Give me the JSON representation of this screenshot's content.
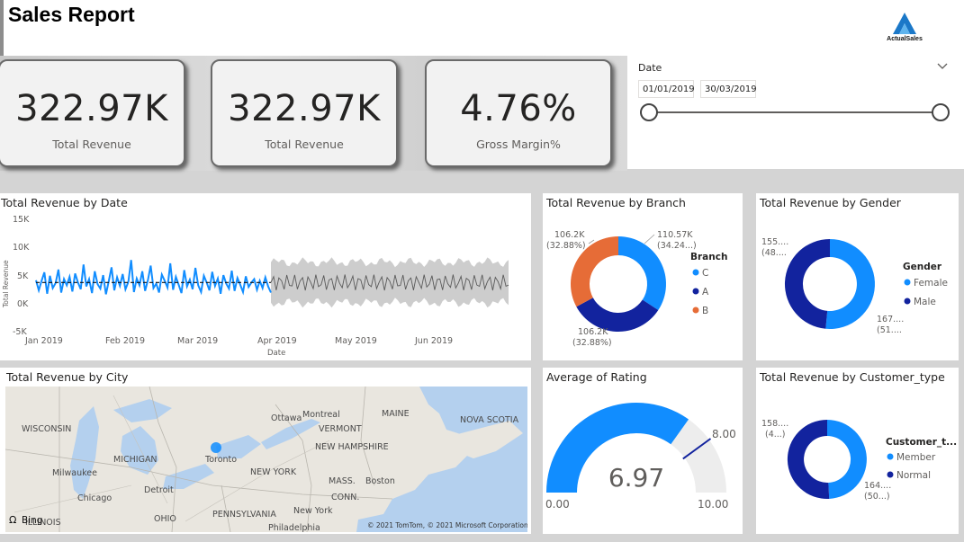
{
  "header": {
    "title": "Sales Report",
    "logo_text": "ActualSales"
  },
  "kpis": [
    {
      "value": "322.97K",
      "label": "Total Revenue"
    },
    {
      "value": "322.97K",
      "label": "Total Revenue"
    },
    {
      "value": "4.76%",
      "label": "Gross Margin%"
    }
  ],
  "slicer": {
    "title": "Date",
    "start": "01/01/2019",
    "end": "30/03/2019"
  },
  "colors": {
    "blue": "#118DFF",
    "navy": "#12239E",
    "orange": "#E66C37",
    "forecast": "#c8c8c8"
  },
  "line_chart": {
    "title": "Total Revenue by Date",
    "ylabel": "Total Revenue",
    "xlabel": "Date",
    "y_ticks": [
      "15K",
      "10K",
      "5K",
      "0K",
      "-5K"
    ],
    "x_ticks": [
      "Jan 2019",
      "Feb 2019",
      "Mar 2019",
      "Apr 2019",
      "May 2019",
      "Jun 2019"
    ]
  },
  "branch_chart": {
    "title": "Total Revenue by Branch",
    "legend_title": "Branch",
    "label_top_left_1": "106.2K",
    "label_top_left_2": "(32.88%)",
    "label_top_right_1": "110.57K",
    "label_top_right_2": "(34.24...)",
    "label_bottom_1": "106.2K",
    "label_bottom_2": "(32.88%)",
    "legend": [
      "C",
      "A",
      "B"
    ]
  },
  "gender_chart": {
    "title": "Total Revenue by Gender",
    "legend_title": "Gender",
    "label_left_1": "155....",
    "label_left_2": "(48....",
    "label_right_1": "167....",
    "label_right_2": "(51....",
    "legend": [
      "Female",
      "Male"
    ]
  },
  "map": {
    "title": "Total Revenue by City",
    "places": [
      "Ottawa",
      "Montreal",
      "MAINE",
      "NOVA SCOTIA",
      "VERMONT",
      "WISCONSIN",
      "NEW HAMPSHIRE",
      "MICHIGAN",
      "Toronto",
      "NEW YORK",
      "Milwaukee",
      "MASS.",
      "Boston",
      "Detroit",
      "Chicago",
      "CONN.",
      "OHIO",
      "PENNSYLVANIA",
      "New York",
      "ILLINOIS",
      "Philadelphia"
    ],
    "bing": "Bing",
    "copyright": "© 2021 TomTom, © 2021 Microsoft Corporation"
  },
  "gauge": {
    "title": "Average of Rating",
    "value_text": "6.97",
    "min_text": "0.00",
    "max_text": "10.00",
    "target_text": "8.00"
  },
  "customer_chart": {
    "title": "Total Revenue by Customer_type",
    "legend_title": "Customer_t...",
    "label_left_1": "158....",
    "label_left_2": "(4...)",
    "label_right_1": "164....",
    "label_right_2": "(50...)",
    "legend": [
      "Member",
      "Normal"
    ]
  },
  "chart_data": [
    {
      "type": "line",
      "title": "Total Revenue by Date",
      "xlabel": "Date",
      "ylabel": "Total Revenue",
      "ylim": [
        -5000,
        15000
      ],
      "x_range": [
        "2019-01-01",
        "2019-07-01"
      ],
      "series": [],
      "actual_daily_values": [
        4000,
        2200,
        3900,
        5400,
        1600,
        4800,
        2600,
        3500,
        5900,
        1800,
        4200,
        3100,
        4600,
        2000,
        5200,
        3600,
        2400,
        6800,
        2900,
        4200,
        1700,
        5600,
        3300,
        2500,
        4900,
        1500,
        3800,
        6300,
        2200,
        4500,
        3000,
        5100,
        2400,
        3700,
        7600,
        1900,
        4300,
        3100,
        5600,
        2100,
        4000,
        6600,
        2600,
        3400,
        1800,
        5000,
        3900,
        2700,
        7000,
        2300,
        4600,
        3200,
        1700,
        5800,
        2900,
        4100,
        2400,
        6200,
        3100,
        1900,
        4800,
        3600,
        2200,
        5500,
        3000,
        4300,
        1600,
        4900,
        3400,
        2500,
        5700,
        2100,
        4400,
        3200,
        1900,
        4700,
        2800,
        3600,
        4200,
        2300,
        3900,
        2600,
        4500,
        2900,
        1800
      ],
      "trend_value": 3600,
      "forecast": {
        "start": "2019-04-01",
        "end": "2019-07-01",
        "center": 3600,
        "band_low": 0,
        "band_high": 7200
      }
    },
    {
      "type": "pie",
      "title": "Total Revenue by Branch",
      "categories": [
        "C",
        "A",
        "B"
      ],
      "values": [
        110.57,
        106.2,
        106.2
      ],
      "units": "K"
    },
    {
      "type": "pie",
      "title": "Total Revenue by Gender",
      "categories": [
        "Female",
        "Male"
      ],
      "values": [
        51.5,
        48.5
      ],
      "units": "%"
    },
    {
      "type": "gauge",
      "title": "Average of Rating",
      "value": 6.97,
      "min": 0,
      "max": 10,
      "target": 8
    },
    {
      "type": "pie",
      "title": "Total Revenue by Customer_type",
      "categories": [
        "Member",
        "Normal"
      ],
      "values": [
        49.2,
        50.8
      ],
      "units": "%"
    }
  ]
}
